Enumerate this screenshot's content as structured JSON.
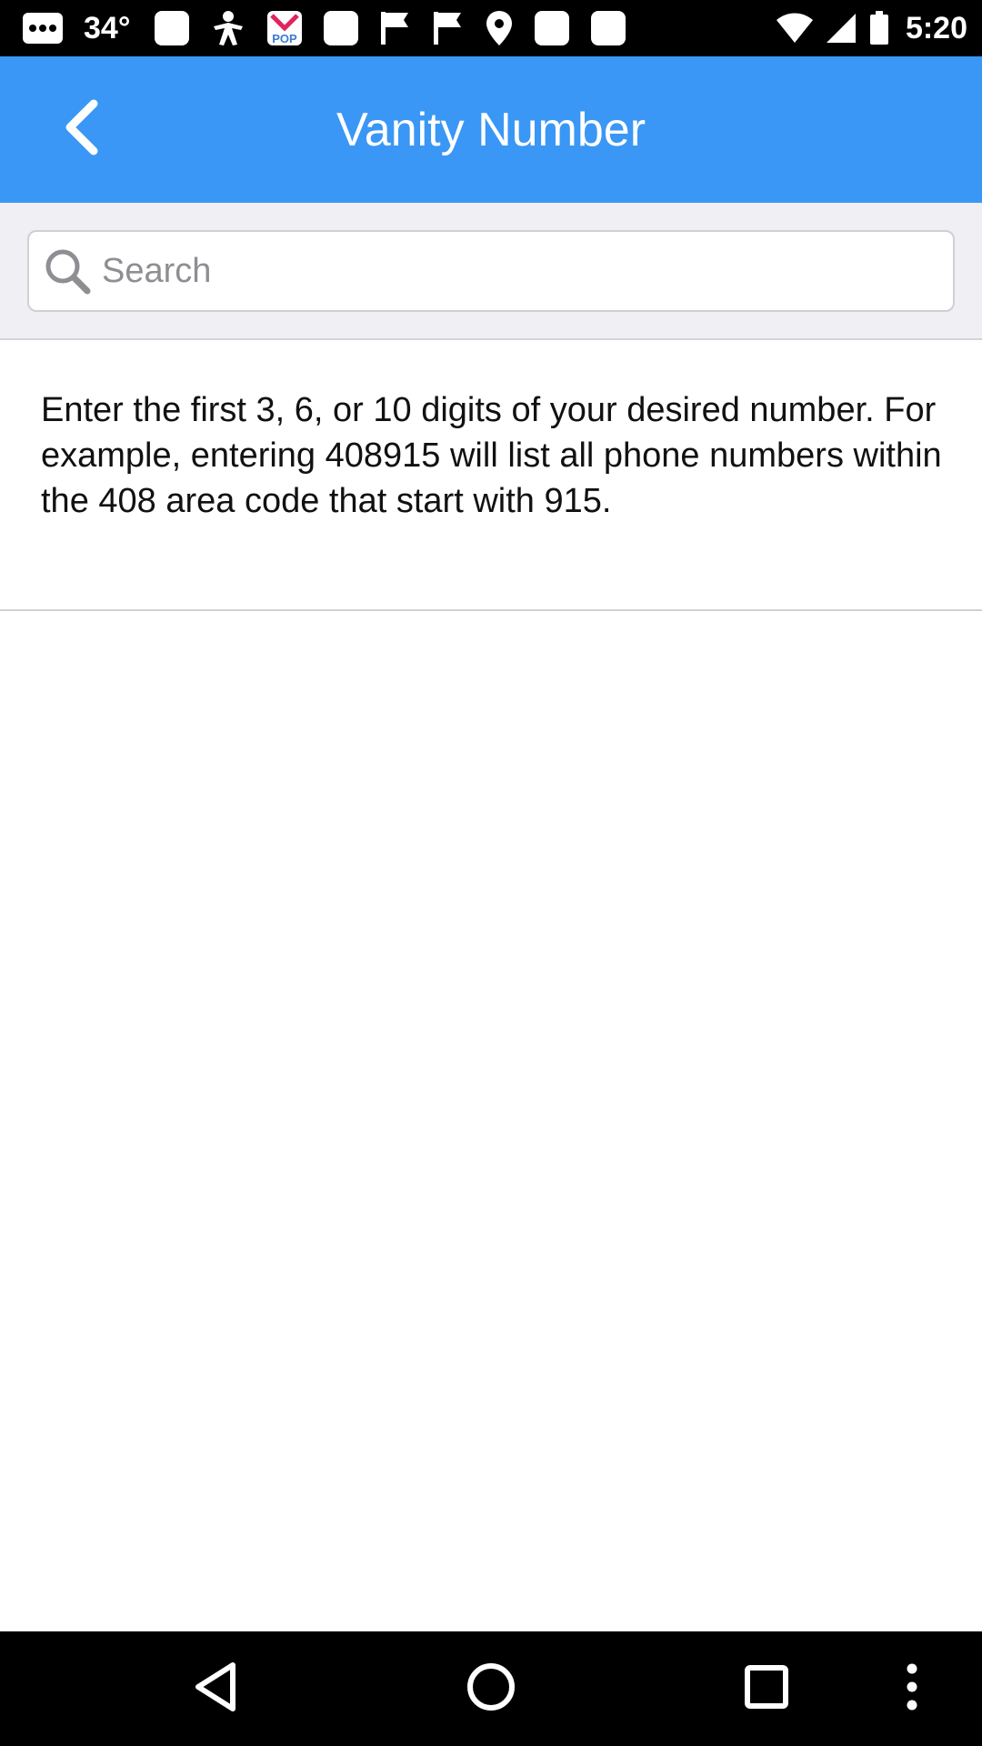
{
  "status_bar": {
    "temperature": "34°",
    "time": "5:20",
    "left_icons": [
      "messages-icon",
      "temperature-label",
      "square-notification-icon",
      "figure-icon",
      "pop-app-icon",
      "square-notification-icon",
      "flag-icon",
      "flag-icon",
      "location-pin-icon",
      "square-notification-icon",
      "square-notification-icon"
    ]
  },
  "app_bar": {
    "title": "Vanity Number",
    "background_color": "#3a97f5",
    "back_icon": "chevron-left-icon"
  },
  "search": {
    "placeholder": "Search",
    "value": "",
    "icon": "search-icon"
  },
  "main": {
    "info_text": "Enter the first 3, 6, or 10 digits of your desired number. For example, entering 408915 will list all phone numbers within the 408 area code that start with 915."
  },
  "nav_bar": {
    "buttons": [
      "back-triangle-icon",
      "home-circle-icon",
      "recents-square-icon",
      "overflow-menu-icon"
    ]
  }
}
